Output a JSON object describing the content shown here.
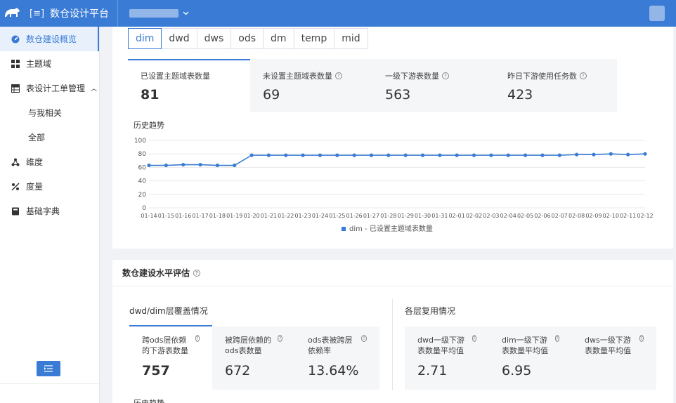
{
  "header": {
    "app_title": "数仓设计平台",
    "app_badge": "[≡]"
  },
  "sidebar": {
    "items": [
      {
        "label": "数仓建设概览"
      },
      {
        "label": "主题域"
      },
      {
        "label": "表设计工单管理"
      },
      {
        "label": "与我相关"
      },
      {
        "label": "全部"
      },
      {
        "label": "维度"
      },
      {
        "label": "度量"
      },
      {
        "label": "基础字典"
      }
    ]
  },
  "layer_tabs": [
    "dim",
    "dwd",
    "dws",
    "ods",
    "dm",
    "temp",
    "mid"
  ],
  "stats": [
    {
      "label": "已设置主题域表数量",
      "value": "81",
      "help": false
    },
    {
      "label": "未设置主题域表数量",
      "value": "69",
      "help": true
    },
    {
      "label": "一级下游表数量",
      "value": "563",
      "help": true
    },
    {
      "label": "昨日下游使用任务数",
      "value": "423",
      "help": true
    }
  ],
  "trend_title": "历史趋势",
  "chart_data": {
    "type": "line",
    "categories": [
      "01-14",
      "01-15",
      "01-16",
      "01-17",
      "01-18",
      "01-19",
      "01-20",
      "01-21",
      "01-22",
      "01-23",
      "01-24",
      "01-25",
      "01-26",
      "01-27",
      "01-28",
      "01-29",
      "01-30",
      "01-31",
      "02-01",
      "02-02",
      "02-03",
      "02-04",
      "02-05",
      "02-06",
      "02-07",
      "02-08",
      "02-09",
      "02-10",
      "02-11",
      "02-12"
    ],
    "series": [
      {
        "name": "dim - 已设置主题域表数量",
        "values": [
          63,
          63,
          64,
          64,
          63,
          63,
          78,
          78,
          78,
          78,
          78,
          78,
          78,
          78,
          78,
          78,
          78,
          78,
          78,
          78,
          78,
          78,
          78,
          78,
          78,
          79,
          79,
          80,
          79,
          80
        ]
      }
    ],
    "ylim": [
      0,
      100
    ],
    "yticks": [
      0,
      20,
      40,
      60,
      80,
      100
    ],
    "grid": true,
    "legend": "bottom-center",
    "color": "#3a7bd5"
  },
  "section2": {
    "title": "数仓建设水平评估",
    "left_title": "dwd/dim层覆盖情况",
    "right_title": "各层复用情况",
    "left_cards": [
      {
        "label": "跨ods层依赖的下游表数量",
        "value": "757"
      },
      {
        "label": "被跨层依赖的ods表数量",
        "value": "672"
      },
      {
        "label": "ods表被跨层依赖率",
        "value": "13.64%"
      }
    ],
    "right_cards": [
      {
        "label": "dwd一级下游表数量平均值",
        "value": "2.71"
      },
      {
        "label": "dim一级下游表数量平均值",
        "value": "6.95"
      },
      {
        "label": "dws一级下游表数量平均值",
        "value": ""
      }
    ],
    "bottom_trend": "历史趋势"
  },
  "colors": {
    "accent": "#3a7bd5",
    "header": "#3a7bd5"
  }
}
